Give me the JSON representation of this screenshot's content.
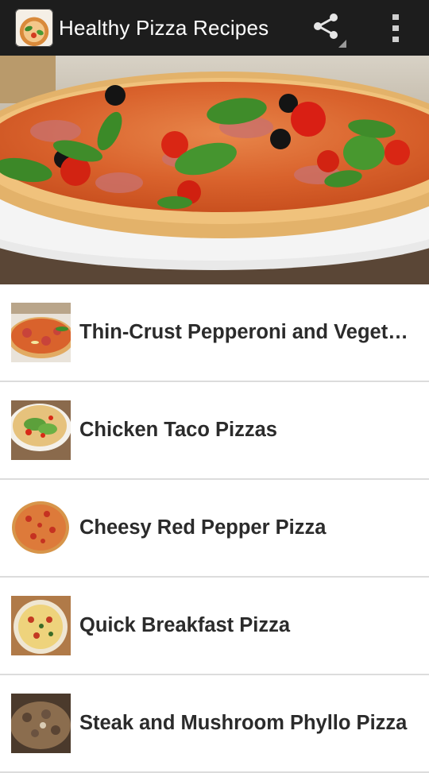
{
  "app": {
    "title": "Healthy Pizza Recipes",
    "icon": "pizza-app-icon"
  },
  "actions": {
    "share_icon": "share-icon",
    "overflow_icon": "overflow-menu-icon"
  },
  "hero": {
    "image": "pizza-hero-photo"
  },
  "recipes": [
    {
      "title": "Thin-Crust Pepperoni and Vegetable Pizza",
      "thumb": "pepperoni-veg-pizza-thumb"
    },
    {
      "title": "Chicken Taco Pizzas",
      "thumb": "chicken-taco-pizza-thumb"
    },
    {
      "title": "Cheesy Red Pepper Pizza",
      "thumb": "red-pepper-pizza-thumb"
    },
    {
      "title": "Quick Breakfast Pizza",
      "thumb": "breakfast-pizza-thumb"
    },
    {
      "title": "Steak and Mushroom Phyllo Pizza",
      "thumb": "steak-mushroom-pizza-thumb"
    }
  ],
  "colors": {
    "actionbar": "#1d1d1d",
    "divider": "#dcdcdc",
    "text": "#2b2b2b"
  }
}
